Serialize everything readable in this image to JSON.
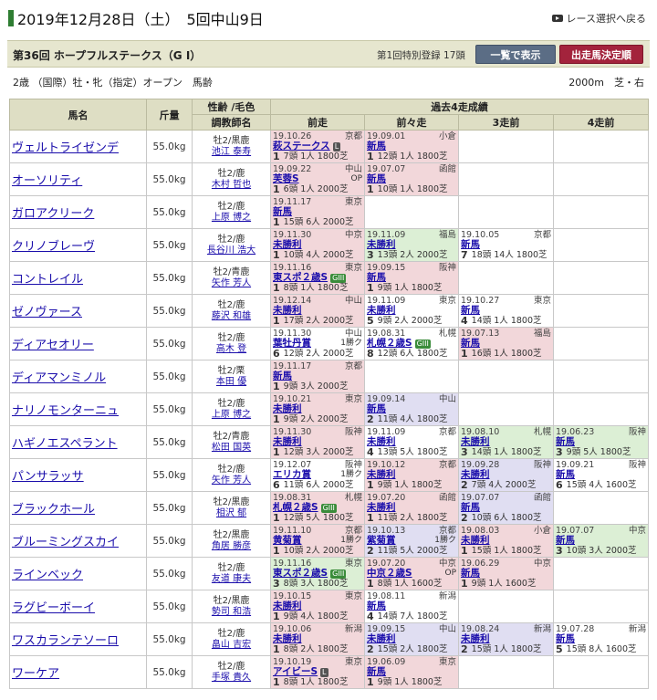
{
  "header": {
    "date_title": "2019年12月28日（土）　5回中山9日",
    "back_label": "レース選択へ戻る"
  },
  "race": {
    "name": "第36回 ホープフルステークス（G I）",
    "entry_info": "第1回特別登録 17頭",
    "btn_list": "一覧で表示",
    "btn_fixed": "出走馬決定順",
    "conditions": "2歳 （国際）牡・牝（指定）オープン　馬齢",
    "distance": "2000m　芝・右"
  },
  "columns": {
    "name": "馬名",
    "weight": "斤量",
    "sex_color": "性齢 /毛色",
    "trainer": "調教師名",
    "past": "過去4走成績",
    "p1": "前走",
    "p2": "前々走",
    "p3": "3走前",
    "p4": "4走前"
  },
  "horses": [
    {
      "name": "ヴェルトライゼンデ",
      "weight": "55.0kg",
      "sex": "牡2/黒鹿",
      "trainer": "池江 泰寿",
      "past": [
        {
          "date": "19.10.26",
          "venue": "京都",
          "race": "萩ステークス",
          "grade": "L",
          "cls": "",
          "pos": "1",
          "detail": "7頭 1人 1800芝",
          "c": "c-win"
        },
        {
          "date": "19.09.01",
          "venue": "小倉",
          "race": "新馬",
          "grade": "",
          "cls": "",
          "pos": "1",
          "detail": "12頭 1人 1800芝",
          "c": "c-win"
        },
        {
          "c": "c-empty"
        },
        {
          "c": "c-empty"
        }
      ]
    },
    {
      "name": "オーソリティ",
      "weight": "55.0kg",
      "sex": "牡2/鹿",
      "trainer": "木村 哲也",
      "past": [
        {
          "date": "19.09.22",
          "venue": "中山",
          "race": "芙蓉S",
          "grade": "",
          "cls": "OP",
          "pos": "1",
          "detail": "6頭 1人 2000芝",
          "c": "c-win"
        },
        {
          "date": "19.07.07",
          "venue": "函館",
          "race": "新馬",
          "grade": "",
          "cls": "",
          "pos": "1",
          "detail": "10頭 1人 1800芝",
          "c": "c-win"
        },
        {
          "c": "c-empty"
        },
        {
          "c": "c-empty"
        }
      ]
    },
    {
      "name": "ガロアクリーク",
      "weight": "55.0kg",
      "sex": "牡2/鹿",
      "trainer": "上原 博之",
      "past": [
        {
          "date": "19.11.17",
          "venue": "東京",
          "race": "新馬",
          "grade": "",
          "cls": "",
          "pos": "1",
          "detail": "15頭 6人 2000芝",
          "c": "c-win"
        },
        {
          "c": "c-empty"
        },
        {
          "c": "c-empty"
        },
        {
          "c": "c-empty"
        }
      ]
    },
    {
      "name": "クリノブレーヴ",
      "weight": "55.0kg",
      "sex": "牡2/鹿",
      "trainer": "長谷川 浩大",
      "past": [
        {
          "date": "19.11.30",
          "venue": "中京",
          "race": "未勝利",
          "grade": "",
          "cls": "",
          "pos": "1",
          "detail": "10頭 4人 2000芝",
          "c": "c-win"
        },
        {
          "date": "19.11.09",
          "venue": "福島",
          "race": "未勝利",
          "grade": "",
          "cls": "",
          "pos": "3",
          "detail": "13頭 2人 2000芝",
          "c": "c-2"
        },
        {
          "date": "19.10.05",
          "venue": "京都",
          "race": "新馬",
          "grade": "",
          "cls": "",
          "pos": "7",
          "detail": "18頭 14人 1800芝",
          "c": "c-other"
        },
        {
          "c": "c-empty"
        }
      ]
    },
    {
      "name": "コントレイル",
      "weight": "55.0kg",
      "sex": "牡2/青鹿",
      "trainer": "矢作 芳人",
      "past": [
        {
          "date": "19.11.16",
          "venue": "東京",
          "race": "東スポ２歳S",
          "grade": "GIII",
          "cls": "",
          "pos": "1",
          "detail": "8頭 1人 1800芝",
          "c": "c-win"
        },
        {
          "date": "19.09.15",
          "venue": "阪神",
          "race": "新馬",
          "grade": "",
          "cls": "",
          "pos": "1",
          "detail": "9頭 1人 1800芝",
          "c": "c-win"
        },
        {
          "c": "c-empty"
        },
        {
          "c": "c-empty"
        }
      ]
    },
    {
      "name": "ゼノヴァース",
      "weight": "55.0kg",
      "sex": "牡2/鹿",
      "trainer": "藤沢 和雄",
      "past": [
        {
          "date": "19.12.14",
          "venue": "中山",
          "race": "未勝利",
          "grade": "",
          "cls": "",
          "pos": "1",
          "detail": "17頭 2人 2000芝",
          "c": "c-win"
        },
        {
          "date": "19.11.09",
          "venue": "東京",
          "race": "未勝利",
          "grade": "",
          "cls": "",
          "pos": "5",
          "detail": "9頭 2人 2000芝",
          "c": "c-other"
        },
        {
          "date": "19.10.27",
          "venue": "東京",
          "race": "新馬",
          "grade": "",
          "cls": "",
          "pos": "4",
          "detail": "14頭 1人 1800芝",
          "c": "c-other"
        },
        {
          "c": "c-empty"
        }
      ]
    },
    {
      "name": "ディアセオリー",
      "weight": "55.0kg",
      "sex": "牡2/鹿",
      "trainer": "高木 登",
      "past": [
        {
          "date": "19.11.30",
          "venue": "中山",
          "race": "葉牡丹賞",
          "grade": "",
          "cls": "1勝ク",
          "pos": "6",
          "detail": "12頭 2人 2000芝",
          "c": "c-other"
        },
        {
          "date": "19.08.31",
          "venue": "札幌",
          "race": "札幌２歳S",
          "grade": "GIII",
          "cls": "",
          "pos": "8",
          "detail": "12頭 6人 1800芝",
          "c": "c-other"
        },
        {
          "date": "19.07.13",
          "venue": "福島",
          "race": "新馬",
          "grade": "",
          "cls": "",
          "pos": "1",
          "detail": "16頭 1人 1800芝",
          "c": "c-win"
        },
        {
          "c": "c-empty"
        }
      ]
    },
    {
      "name": "ディアマンミノル",
      "weight": "55.0kg",
      "sex": "牡2/栗",
      "trainer": "本田 優",
      "past": [
        {
          "date": "19.11.17",
          "venue": "京都",
          "race": "新馬",
          "grade": "",
          "cls": "",
          "pos": "1",
          "detail": "9頭 3人 2000芝",
          "c": "c-win"
        },
        {
          "c": "c-empty"
        },
        {
          "c": "c-empty"
        },
        {
          "c": "c-empty"
        }
      ]
    },
    {
      "name": "ナリノモンターニュ",
      "weight": "55.0kg",
      "sex": "牡2/鹿",
      "trainer": "上原 博之",
      "past": [
        {
          "date": "19.10.21",
          "venue": "東京",
          "race": "未勝利",
          "grade": "",
          "cls": "",
          "pos": "1",
          "detail": "9頭 2人 2000芝",
          "c": "c-win"
        },
        {
          "date": "19.09.14",
          "venue": "中山",
          "race": "新馬",
          "grade": "",
          "cls": "",
          "pos": "2",
          "detail": "11頭 4人 1800芝",
          "c": "c-3"
        },
        {
          "c": "c-empty"
        },
        {
          "c": "c-empty"
        }
      ]
    },
    {
      "name": "ハギノエスペラント",
      "weight": "55.0kg",
      "sex": "牡2/青鹿",
      "trainer": "松田 国英",
      "past": [
        {
          "date": "19.11.30",
          "venue": "阪神",
          "race": "未勝利",
          "grade": "",
          "cls": "",
          "pos": "1",
          "detail": "12頭 3人 2000芝",
          "c": "c-win"
        },
        {
          "date": "19.11.09",
          "venue": "京都",
          "race": "未勝利",
          "grade": "",
          "cls": "",
          "pos": "4",
          "detail": "13頭 5人 1800芝",
          "c": "c-other"
        },
        {
          "date": "19.08.10",
          "venue": "札幌",
          "race": "未勝利",
          "grade": "",
          "cls": "",
          "pos": "3",
          "detail": "14頭 1人 1800芝",
          "c": "c-2"
        },
        {
          "date": "19.06.23",
          "venue": "阪神",
          "race": "新馬",
          "grade": "",
          "cls": "",
          "pos": "3",
          "detail": "9頭 5人 1800芝",
          "c": "c-2"
        }
      ]
    },
    {
      "name": "パンサラッサ",
      "weight": "55.0kg",
      "sex": "牡2/鹿",
      "trainer": "矢作 芳人",
      "past": [
        {
          "date": "19.12.07",
          "venue": "阪神",
          "race": "エリカ賞",
          "grade": "",
          "cls": "1勝ク",
          "pos": "6",
          "detail": "11頭 6人 2000芝",
          "c": "c-other"
        },
        {
          "date": "19.10.12",
          "venue": "京都",
          "race": "未勝利",
          "grade": "",
          "cls": "",
          "pos": "1",
          "detail": "9頭 1人 1800芝",
          "c": "c-win"
        },
        {
          "date": "19.09.28",
          "venue": "阪神",
          "race": "未勝利",
          "grade": "",
          "cls": "",
          "pos": "2",
          "detail": "7頭 4人 2000芝",
          "c": "c-3"
        },
        {
          "date": "19.09.21",
          "venue": "阪神",
          "race": "新馬",
          "grade": "",
          "cls": "",
          "pos": "6",
          "detail": "15頭 4人 1600芝",
          "c": "c-other"
        }
      ]
    },
    {
      "name": "ブラックホール",
      "weight": "55.0kg",
      "sex": "牡2/黒鹿",
      "trainer": "相沢 郁",
      "past": [
        {
          "date": "19.08.31",
          "venue": "札幌",
          "race": "札幌２歳S",
          "grade": "GIII",
          "cls": "",
          "pos": "1",
          "detail": "12頭 5人 1800芝",
          "c": "c-win"
        },
        {
          "date": "19.07.20",
          "venue": "函館",
          "race": "未勝利",
          "grade": "",
          "cls": "",
          "pos": "1",
          "detail": "11頭 2人 1800芝",
          "c": "c-win"
        },
        {
          "date": "19.07.07",
          "venue": "函館",
          "race": "新馬",
          "grade": "",
          "cls": "",
          "pos": "2",
          "detail": "10頭 6人 1800芝",
          "c": "c-3"
        },
        {
          "c": "c-empty"
        }
      ]
    },
    {
      "name": "ブルーミングスカイ",
      "weight": "55.0kg",
      "sex": "牡2/黒鹿",
      "trainer": "角居 勝彦",
      "past": [
        {
          "date": "19.11.10",
          "venue": "京都",
          "race": "黄菊賞",
          "grade": "",
          "cls": "1勝ク",
          "pos": "1",
          "detail": "10頭 2人 2000芝",
          "c": "c-win"
        },
        {
          "date": "19.10.13",
          "venue": "京都",
          "race": "紫菊賞",
          "grade": "",
          "cls": "1勝ク",
          "pos": "2",
          "detail": "11頭 5人 2000芝",
          "c": "c-3"
        },
        {
          "date": "19.08.03",
          "venue": "小倉",
          "race": "未勝利",
          "grade": "",
          "cls": "",
          "pos": "1",
          "detail": "15頭 1人 1800芝",
          "c": "c-win"
        },
        {
          "date": "19.07.07",
          "venue": "中京",
          "race": "新馬",
          "grade": "",
          "cls": "",
          "pos": "3",
          "detail": "10頭 3人 2000芝",
          "c": "c-2"
        }
      ]
    },
    {
      "name": "ラインベック",
      "weight": "55.0kg",
      "sex": "牡2/鹿",
      "trainer": "友道 康夫",
      "past": [
        {
          "date": "19.11.16",
          "venue": "東京",
          "race": "東スポ２歳S",
          "grade": "GIII",
          "cls": "",
          "pos": "3",
          "detail": "8頭 3人 1800芝",
          "c": "c-2"
        },
        {
          "date": "19.07.20",
          "venue": "中京",
          "race": "中京２歳S",
          "grade": "",
          "cls": "OP",
          "pos": "1",
          "detail": "8頭 1人 1600芝",
          "c": "c-win"
        },
        {
          "date": "19.06.29",
          "venue": "中京",
          "race": "新馬",
          "grade": "",
          "cls": "",
          "pos": "1",
          "detail": "9頭 1人 1600芝",
          "c": "c-win"
        },
        {
          "c": "c-empty"
        }
      ]
    },
    {
      "name": "ラグビーボーイ",
      "weight": "55.0kg",
      "sex": "牡2/黒鹿",
      "trainer": "勢司 和浩",
      "past": [
        {
          "date": "19.10.15",
          "venue": "東京",
          "race": "未勝利",
          "grade": "",
          "cls": "",
          "pos": "1",
          "detail": "9頭 4人 1800芝",
          "c": "c-win"
        },
        {
          "date": "19.08.11",
          "venue": "新潟",
          "race": "新馬",
          "grade": "",
          "cls": "",
          "pos": "4",
          "detail": "14頭 7人 1800芝",
          "c": "c-other"
        },
        {
          "c": "c-empty"
        },
        {
          "c": "c-empty"
        }
      ]
    },
    {
      "name": "ワスカランテソーロ",
      "weight": "55.0kg",
      "sex": "牡2/鹿",
      "trainer": "畠山 吉宏",
      "past": [
        {
          "date": "19.10.06",
          "venue": "新潟",
          "race": "未勝利",
          "grade": "",
          "cls": "",
          "pos": "1",
          "detail": "8頭 2人 1800芝",
          "c": "c-win"
        },
        {
          "date": "19.09.15",
          "venue": "中山",
          "race": "未勝利",
          "grade": "",
          "cls": "",
          "pos": "2",
          "detail": "15頭 2人 1800芝",
          "c": "c-3"
        },
        {
          "date": "19.08.24",
          "venue": "新潟",
          "race": "未勝利",
          "grade": "",
          "cls": "",
          "pos": "2",
          "detail": "15頭 1人 1800芝",
          "c": "c-3"
        },
        {
          "date": "19.07.28",
          "venue": "新潟",
          "race": "新馬",
          "grade": "",
          "cls": "",
          "pos": "5",
          "detail": "15頭 8人 1600芝",
          "c": "c-other"
        }
      ]
    },
    {
      "name": "ワーケア",
      "weight": "55.0kg",
      "sex": "牡2/鹿",
      "trainer": "手塚 貴久",
      "past": [
        {
          "date": "19.10.19",
          "venue": "東京",
          "race": "アイビーS",
          "grade": "L",
          "cls": "",
          "pos": "1",
          "detail": "8頭 1人 1800芝",
          "c": "c-win"
        },
        {
          "date": "19.06.09",
          "venue": "東京",
          "race": "新馬",
          "grade": "",
          "cls": "",
          "pos": "1",
          "detail": "9頭 1人 1800芝",
          "c": "c-win"
        },
        {
          "c": "c-empty"
        },
        {
          "c": "c-empty"
        }
      ]
    }
  ]
}
